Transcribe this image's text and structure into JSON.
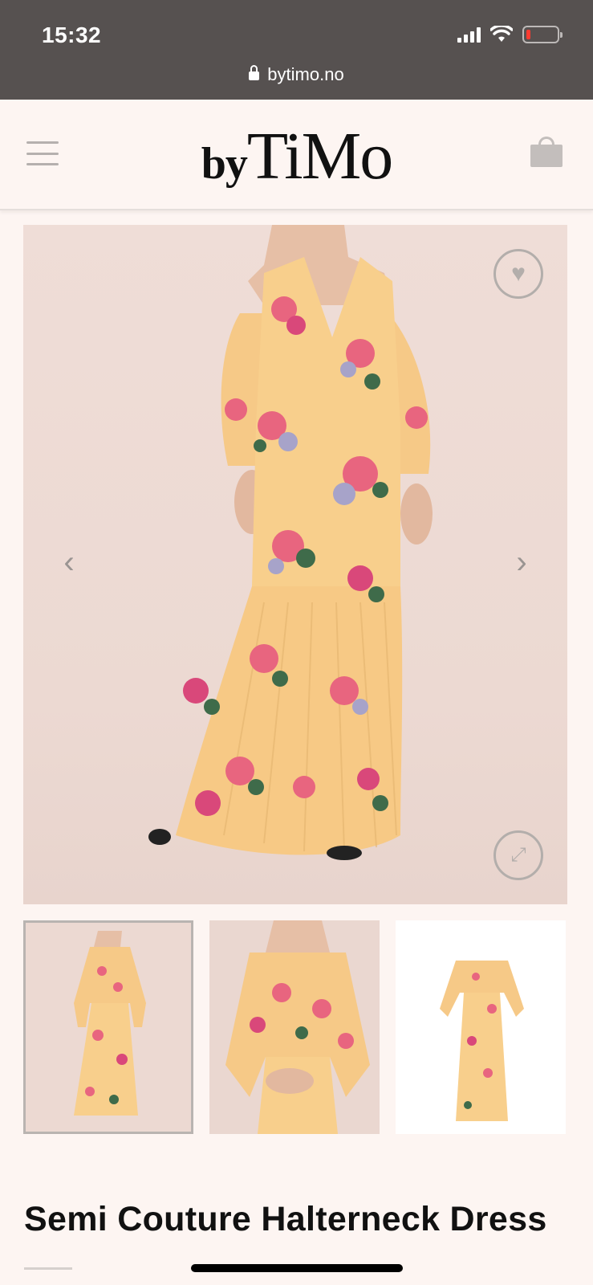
{
  "status_bar": {
    "time": "15:32",
    "url": "bytimo.no"
  },
  "header": {
    "logo_by": "by",
    "logo_brand": "TiMo"
  },
  "product": {
    "title": "Semi Couture Halterneck Dress",
    "dress_colors": {
      "base": "#f8cf8c",
      "floral_pink": "#e8657f",
      "floral_magenta": "#d9487a",
      "leaf": "#3f6b4a",
      "lilac": "#a7a3c9"
    }
  },
  "icons": {
    "menu": "hamburger-icon",
    "cart": "shopping-bag-icon",
    "wishlist": "heart-icon",
    "zoom": "expand-icon",
    "prev": "chevron-left-icon",
    "next": "chevron-right-icon",
    "lock": "lock-icon"
  },
  "gallery": {
    "thumbnail_count": 3,
    "selected_index": 0
  }
}
